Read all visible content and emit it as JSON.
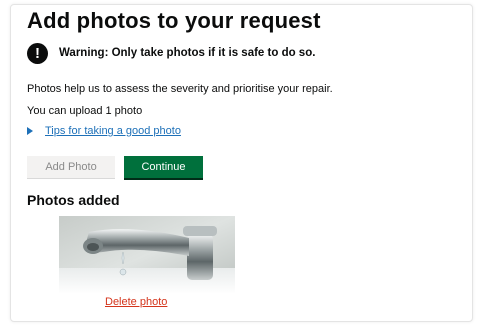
{
  "page": {
    "title": "Add photos to your request",
    "warning": {
      "icon": "exclamation-icon",
      "icon_glyph": "!",
      "text": "Warning: Only take photos if it is safe to do so."
    },
    "intro": "Photos help us to assess the severity and prioritise your repair.",
    "upload_limit": "You can upload 1 photo",
    "tips_link": "Tips for taking a good photo"
  },
  "buttons": {
    "add_photo": "Add Photo",
    "continue": "Continue"
  },
  "photos": {
    "heading": "Photos added",
    "items": [
      {
        "image": "dripping-tap-photo",
        "delete_label": "Delete photo"
      }
    ]
  },
  "colors": {
    "continue_button": "#00703c",
    "link": "#1d70b8",
    "delete_link": "#d4351c"
  }
}
